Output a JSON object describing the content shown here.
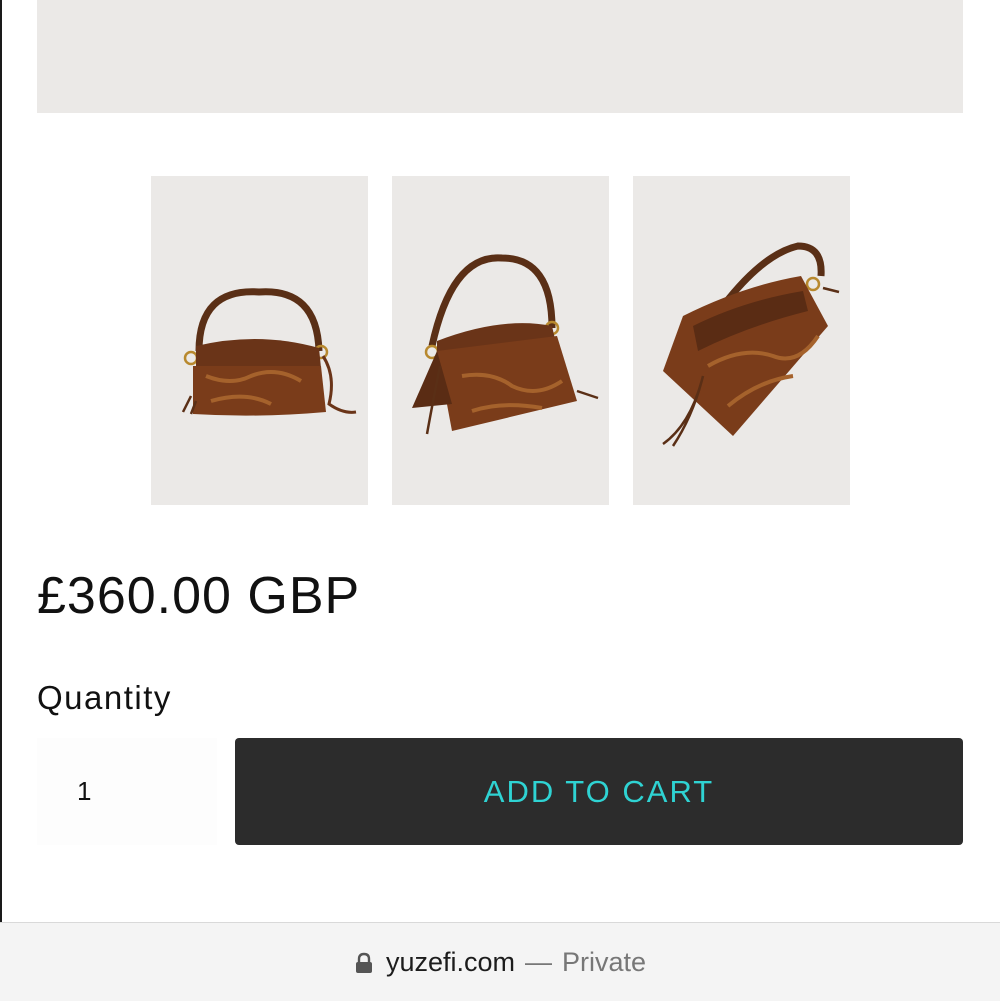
{
  "product": {
    "price": "£360.00 GBP",
    "quantity_label": "Quantity",
    "quantity_value": "1",
    "add_to_cart_label": "ADD TO CART"
  },
  "colors": {
    "accent": "#2fd3d3",
    "button_bg": "#2c2c2c",
    "image_bg": "#ebe9e7"
  },
  "url_bar": {
    "icon": "lock-icon",
    "domain": "yuzefi.com",
    "separator": "—",
    "mode": "Private"
  }
}
